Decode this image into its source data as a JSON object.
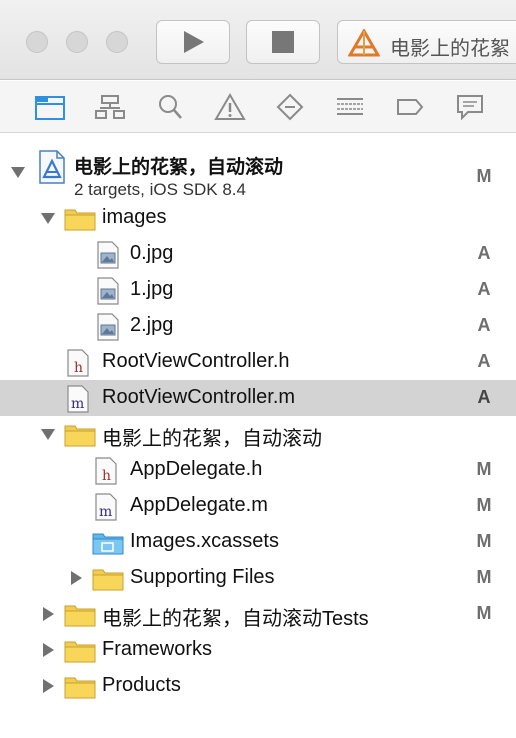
{
  "toolbar": {
    "scheme_label": "电影上的花絮"
  },
  "project": {
    "name": "电影上的花絮，自动滚动",
    "subtitle": "2 targets, iOS SDK 8.4",
    "status": "M"
  },
  "tree": [
    {
      "label": "images",
      "status": "",
      "icon": "folder-icon",
      "expanded": true
    },
    {
      "label": "0.jpg",
      "status": "A",
      "icon": "image-file-icon"
    },
    {
      "label": "1.jpg",
      "status": "A",
      "icon": "image-file-icon"
    },
    {
      "label": "2.jpg",
      "status": "A",
      "icon": "image-file-icon"
    },
    {
      "label": "RootViewController.h",
      "status": "A",
      "icon": "header-file-icon"
    },
    {
      "label": "RootViewController.m",
      "status": "A",
      "icon": "implementation-file-icon",
      "selected": true
    },
    {
      "label": "电影上的花絮，自动滚动",
      "status": "",
      "icon": "folder-icon",
      "expanded": true
    },
    {
      "label": "AppDelegate.h",
      "status": "M",
      "icon": "header-file-icon"
    },
    {
      "label": "AppDelegate.m",
      "status": "M",
      "icon": "implementation-file-icon"
    },
    {
      "label": "Images.xcassets",
      "status": "M",
      "icon": "asset-catalog-icon"
    },
    {
      "label": "Supporting Files",
      "status": "M",
      "icon": "folder-icon",
      "expanded": false
    },
    {
      "label": "电影上的花絮，自动滚动Tests",
      "status": "M",
      "icon": "folder-icon",
      "expanded": false
    },
    {
      "label": "Frameworks",
      "status": "",
      "icon": "folder-icon",
      "expanded": false
    },
    {
      "label": "Products",
      "status": "",
      "icon": "folder-icon",
      "expanded": false
    }
  ]
}
